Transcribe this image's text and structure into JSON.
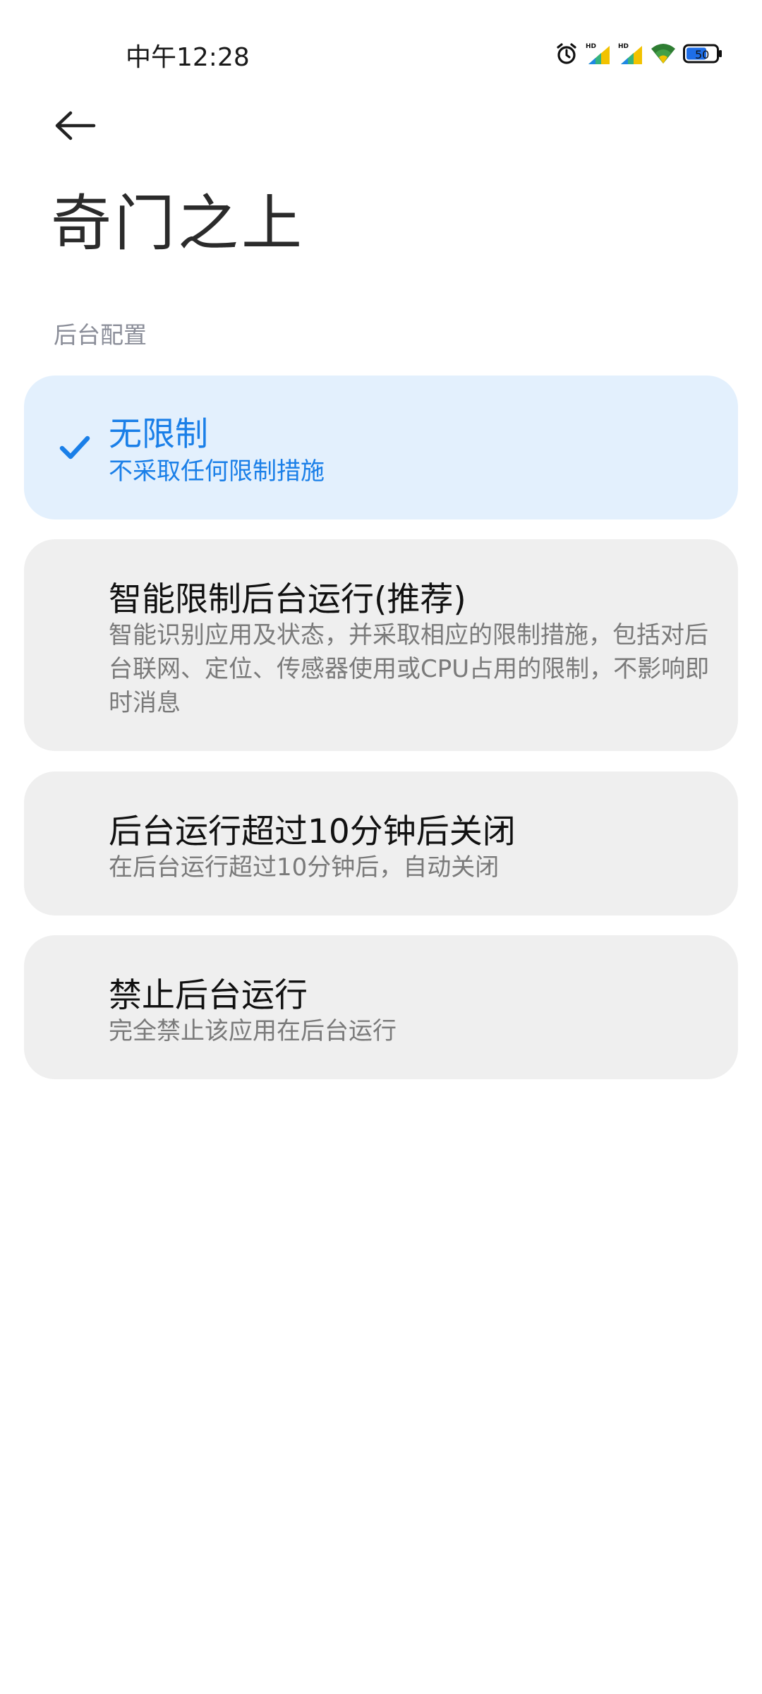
{
  "status_bar": {
    "time": "中午12:28",
    "battery": "50",
    "icons": [
      "alarm-icon",
      "signal-hd-icon",
      "signal-hd-icon",
      "wifi-icon",
      "battery-icon"
    ]
  },
  "nav": {
    "back_icon": "arrow-left-icon"
  },
  "page": {
    "title": "奇门之上",
    "section_header": "后台配置"
  },
  "options": [
    {
      "title": "无限制",
      "desc": "不采取任何限制措施",
      "selected": true
    },
    {
      "title": "智能限制后台运行(推荐)",
      "desc": "智能识别应用及状态，并采取相应的限制措施，包括对后台联网、定位、传感器使用或CPU占用的限制，不影响即时消息",
      "selected": false
    },
    {
      "title": "后台运行超过10分钟后关闭",
      "desc": "在后台运行超过10分钟后，自动关闭",
      "selected": false
    },
    {
      "title": "禁止后台运行",
      "desc": "完全禁止该应用在后台运行",
      "selected": false
    }
  ],
  "colors": {
    "accent": "#1a7fe8",
    "selected_bg": "#e3f0fd",
    "card_bg": "#efefef"
  }
}
